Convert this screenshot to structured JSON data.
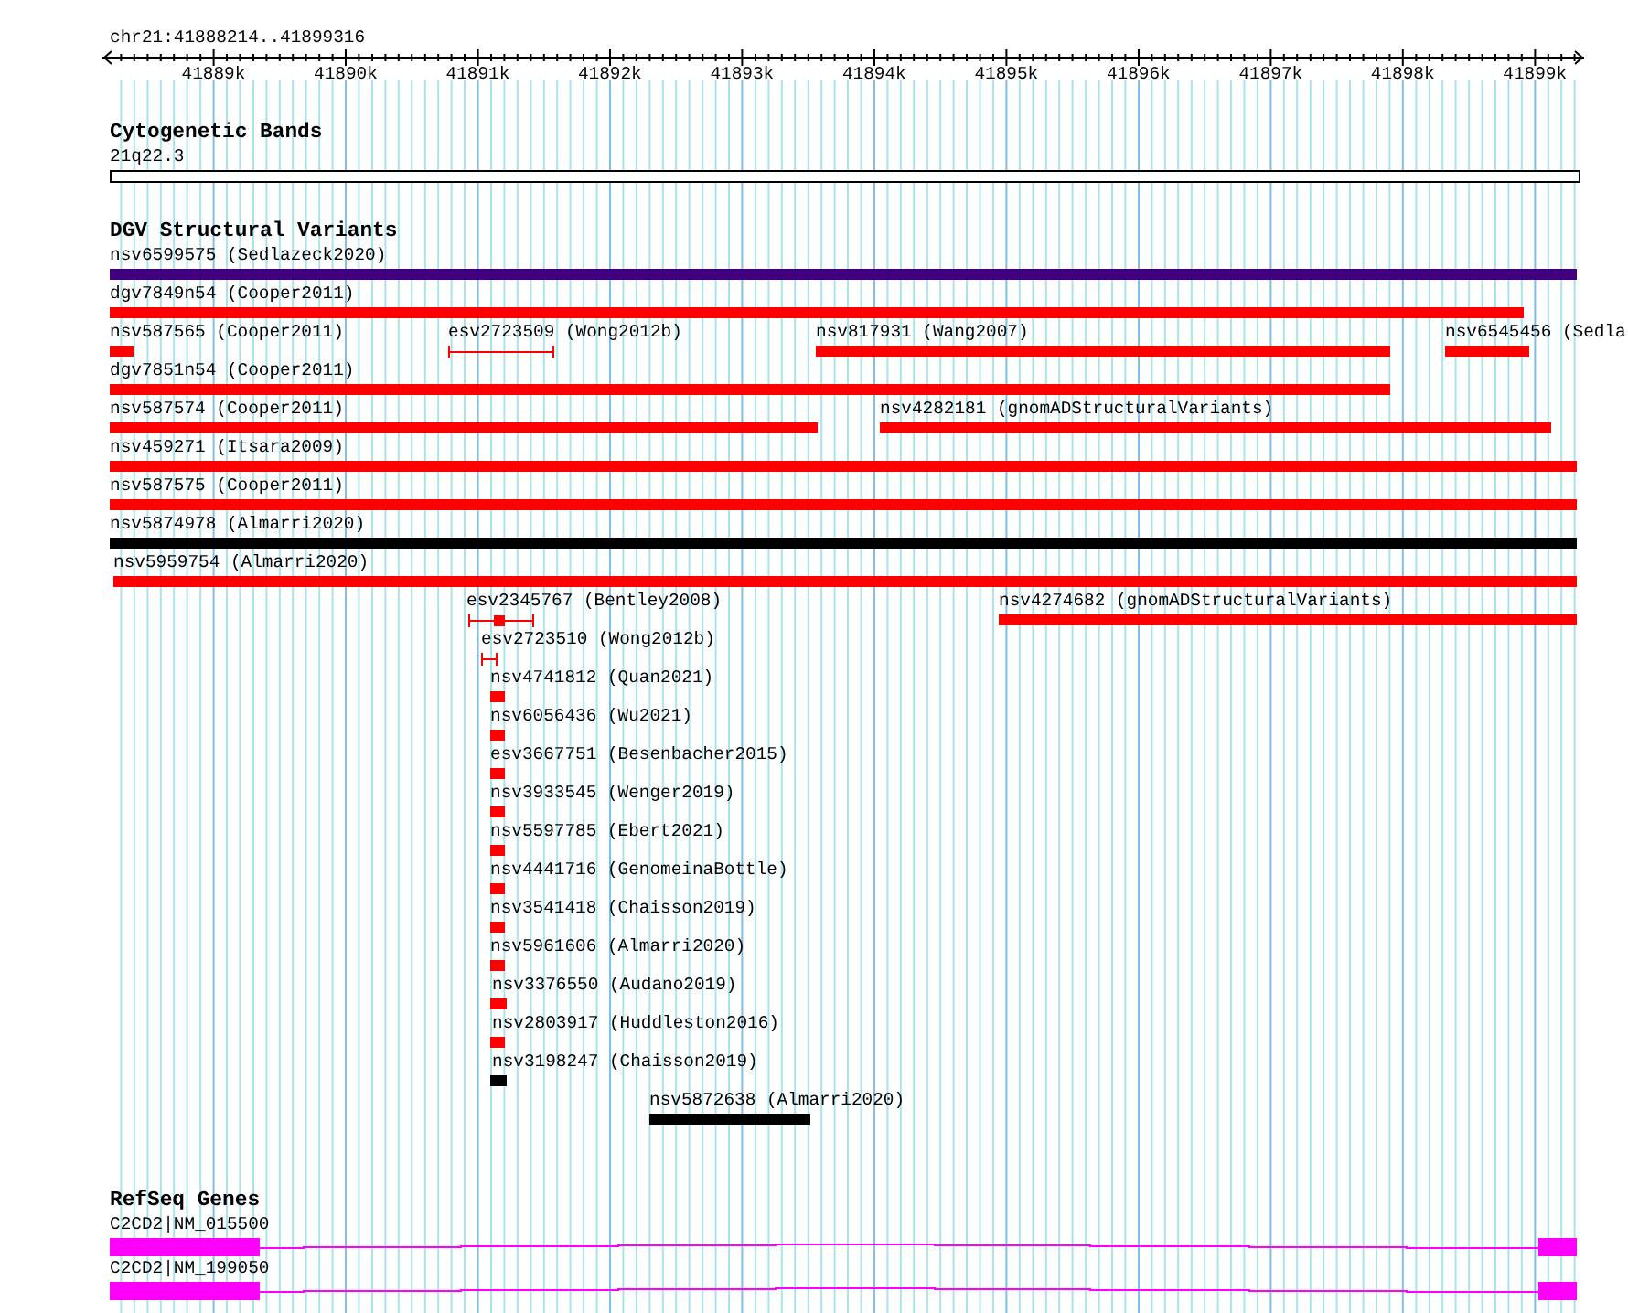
{
  "locus": "chr21:41888214..41899316",
  "ruler_ticks": [
    "41889k",
    "41890k",
    "41891k",
    "41892k",
    "41893k",
    "41894k",
    "41895k",
    "41896k",
    "41897k",
    "41898k",
    "41899k"
  ],
  "cytogenetic_bands": {
    "title": "Cytogenetic Bands",
    "bands": [
      {
        "label": "21q22.3"
      }
    ]
  },
  "dgv": {
    "title": "DGV Structural Variants",
    "features": [
      {
        "label": "nsv6599575 (Sedlazeck2020)",
        "kind": "bar",
        "color": "#400080"
      },
      {
        "label": "dgv7849n54 (Cooper2011)",
        "kind": "bar",
        "color": "#ff0000"
      },
      {
        "label": "nsv587565 (Cooper2011)",
        "kind": "bar",
        "color": "#ff0000"
      },
      {
        "label": "esv2723509 (Wong2012b)",
        "kind": "interval",
        "color": "#ff0000"
      },
      {
        "label": "nsv817931 (Wang2007)",
        "kind": "bar",
        "color": "#ff0000"
      },
      {
        "label": "nsv6545456 (Sedla",
        "kind": "bar",
        "color": "#ff0000"
      },
      {
        "label": "dgv7851n54 (Cooper2011)",
        "kind": "bar",
        "color": "#ff0000"
      },
      {
        "label": "nsv587574 (Cooper2011)",
        "kind": "bar",
        "color": "#ff0000"
      },
      {
        "label": "nsv4282181 (gnomADStructuralVariants)",
        "kind": "bar",
        "color": "#ff0000"
      },
      {
        "label": "nsv459271 (Itsara2009)",
        "kind": "bar",
        "color": "#ff0000"
      },
      {
        "label": "nsv587575 (Cooper2011)",
        "kind": "bar",
        "color": "#ff0000"
      },
      {
        "label": "nsv5874978 (Almarri2020)",
        "kind": "bar",
        "color": "#000000"
      },
      {
        "label": "nsv5959754 (Almarri2020)",
        "kind": "bar",
        "color": "#ff0000"
      },
      {
        "label": "esv2345767 (Bentley2008)",
        "kind": "composite",
        "color": "#ff0000"
      },
      {
        "label": "nsv4274682 (gnomADStructuralVariants)",
        "kind": "bar",
        "color": "#ff0000"
      },
      {
        "label": "esv2723510 (Wong2012b)",
        "kind": "interval",
        "color": "#ff0000"
      },
      {
        "label": "nsv4741812 (Quan2021)",
        "kind": "bar",
        "color": "#ff0000"
      },
      {
        "label": "nsv6056436 (Wu2021)",
        "kind": "bar",
        "color": "#ff0000"
      },
      {
        "label": "esv3667751 (Besenbacher2015)",
        "kind": "bar",
        "color": "#ff0000"
      },
      {
        "label": "nsv3933545 (Wenger2019)",
        "kind": "bar",
        "color": "#ff0000"
      },
      {
        "label": "nsv5597785 (Ebert2021)",
        "kind": "bar",
        "color": "#ff0000"
      },
      {
        "label": "nsv4441716 (GenomeinaBottle)",
        "kind": "bar",
        "color": "#ff0000"
      },
      {
        "label": "nsv3541418 (Chaisson2019)",
        "kind": "bar",
        "color": "#ff0000"
      },
      {
        "label": "nsv5961606 (Almarri2020)",
        "kind": "bar",
        "color": "#ff0000"
      },
      {
        "label": "nsv3376550 (Audano2019)",
        "kind": "bar",
        "color": "#ff0000"
      },
      {
        "label": "nsv2803917 (Huddleston2016)",
        "kind": "bar",
        "color": "#ff0000"
      },
      {
        "label": "nsv3198247 (Chaisson2019)",
        "kind": "bar",
        "color": "#000000"
      },
      {
        "label": "nsv5872638 (Almarri2020)",
        "kind": "bar",
        "color": "#000000"
      }
    ]
  },
  "refseq": {
    "title": "RefSeq Genes",
    "genes": [
      {
        "label": "C2CD2|NM_015500"
      },
      {
        "label": "C2CD2|NM_199050"
      }
    ]
  }
}
